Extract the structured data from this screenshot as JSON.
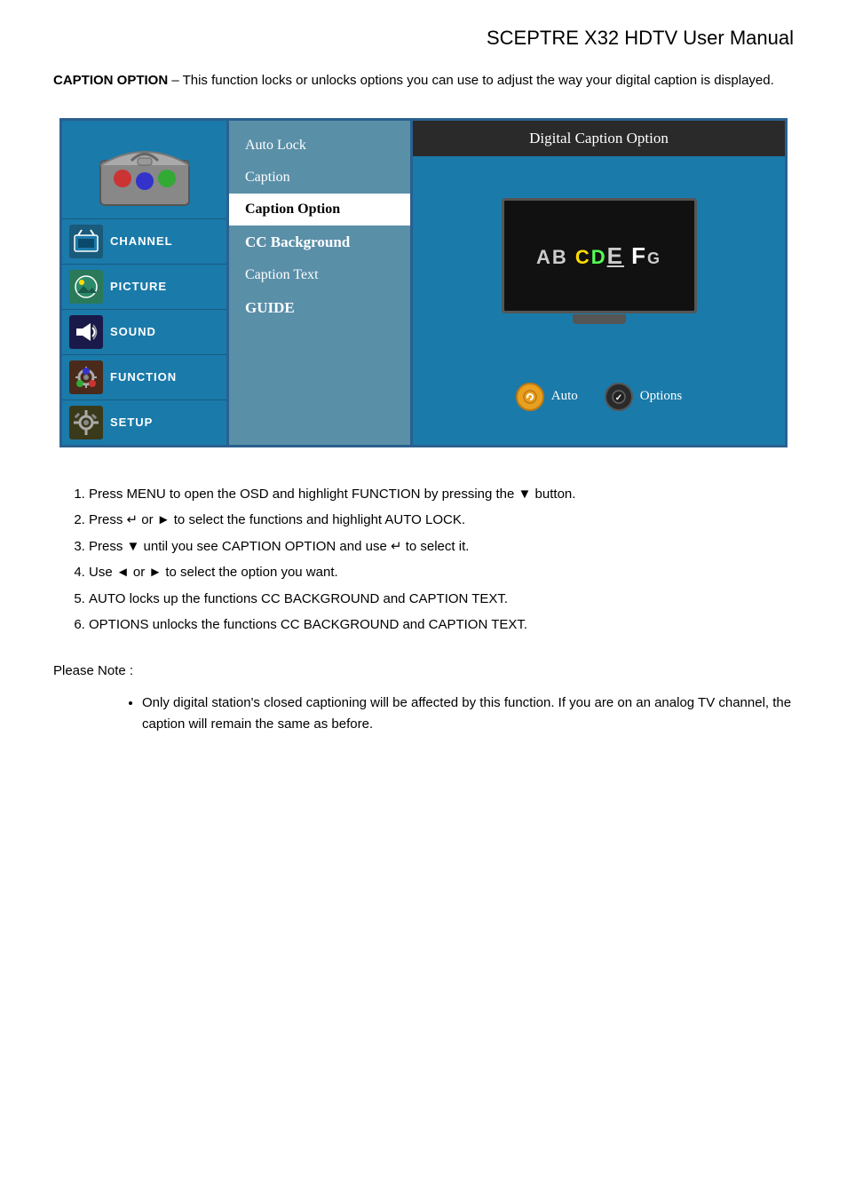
{
  "header": {
    "title": "SCEPTRE X32 HDTV User Manual"
  },
  "intro": {
    "label": "CAPTION OPTION",
    "text": " – This function locks or unlocks options you can use to adjust the way your digital caption is displayed."
  },
  "osd": {
    "left_panel": {
      "menu_items": [
        {
          "id": "channel",
          "label": "CHANNEL",
          "icon": "📡"
        },
        {
          "id": "picture",
          "label": "PICTURE",
          "icon": "🖼"
        },
        {
          "id": "sound",
          "label": "SOUND",
          "icon": "🔊"
        },
        {
          "id": "function",
          "label": "FUNCTION",
          "icon": "⚙"
        },
        {
          "id": "setup",
          "label": "SETUP",
          "icon": "🔧"
        }
      ]
    },
    "middle_panel": {
      "items": [
        {
          "id": "auto-lock",
          "label": "Auto Lock",
          "selected": false,
          "bold": false
        },
        {
          "id": "caption",
          "label": "Caption",
          "selected": false,
          "bold": false
        },
        {
          "id": "caption-option",
          "label": "Caption Option",
          "selected": true,
          "bold": false
        },
        {
          "id": "cc-background",
          "label": "CC Background",
          "selected": false,
          "bold": true
        },
        {
          "id": "caption-text",
          "label": "Caption Text",
          "selected": false,
          "bold": false
        },
        {
          "id": "guide",
          "label": "GUIDE",
          "selected": false,
          "bold": true
        }
      ]
    },
    "right_panel": {
      "title": "Digital Caption Option",
      "tv_text": "AB CD EF G",
      "buttons": [
        {
          "id": "auto",
          "label": "Auto"
        },
        {
          "id": "options",
          "label": "Options"
        }
      ]
    }
  },
  "instructions": {
    "items": [
      "Press MENU to open the OSD and highlight FUNCTION by pressing the ▼ button.",
      "Press ↵ or ► to select the functions and highlight AUTO LOCK.",
      "Press ▼ until you see CAPTION OPTION and use ↵ to select it.",
      "Use ◄ or ► to select the option you want.",
      "AUTO locks up the functions CC BACKGROUND and CAPTION TEXT.",
      "OPTIONS unlocks the functions CC BACKGROUND and CAPTION TEXT."
    ]
  },
  "please_note": {
    "label": "Please Note :",
    "bullets": [
      "Only digital station's closed captioning will be affected by this function.  If you are on an analog TV channel, the caption will remain the same as before."
    ]
  }
}
